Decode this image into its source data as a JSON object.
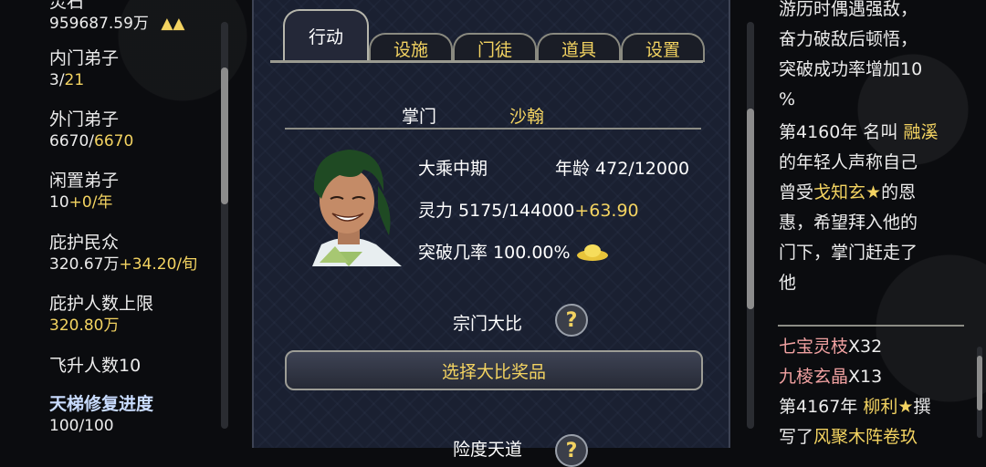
{
  "left": {
    "stats": [
      {
        "label": "灵石",
        "value": "959687.59万",
        "extra": "▲▲"
      },
      {
        "label": "内门弟子",
        "value_a": "3/",
        "value_b": "21"
      },
      {
        "label": "外门弟子",
        "value_a": "6670/",
        "value_b": "6670"
      },
      {
        "label": "闲置弟子",
        "value_a": "10",
        "value_b": "+0/年"
      },
      {
        "label": "庇护民众",
        "value_a": "320.67万",
        "value_b": "+34.20/旬"
      },
      {
        "label": "庇护人数上限",
        "value_b": "320.80万"
      },
      {
        "label": "飞升人数10"
      },
      {
        "label": "天梯修复进度",
        "value_a": "100/100"
      }
    ]
  },
  "tabs": [
    "行动",
    "设施",
    "门徒",
    "道具",
    "设置"
  ],
  "leader": {
    "title_label": "掌门",
    "name": "沙翰",
    "realm": "大乘中期",
    "age": "年龄 472/12000",
    "spirit_a": "灵力 5175/144000",
    "spirit_b": "+63.90",
    "breakthrough": "突破几率 100.00%"
  },
  "tournament": {
    "label": "宗门大比",
    "help": "?",
    "button": "选择大比奖品",
    "next_label": "险度天道"
  },
  "log": {
    "l1": "游历时偶遇强敌，",
    "l2": "奋力破敌后顿悟，",
    "l3": "突破成功率增加10",
    "l4": "%",
    "e2_a": "第4160年 名叫 ",
    "e2_name": "融溪",
    "e2_b": "的年轻人声称自己",
    "e2_c": "曾受",
    "e2_person": "戈知玄★",
    "e2_d": "的恩",
    "e2_e": "惠，希望拜入他的",
    "e2_f": "门下，掌门赶走了",
    "e2_g": "他",
    "item1_name": "七宝灵枝",
    "item1_qty": "X32",
    "item2_name": "九棱玄晶",
    "item2_qty": "X13",
    "e3_a": "第4167年 ",
    "e3_name": "柳利★",
    "e3_b": "撰",
    "e3_c": "写了",
    "e3_item": "风聚木阵卷玖"
  },
  "colors": {
    "accent": "#f3d361",
    "panel": "#1a2031",
    "item": "#f0a0a0"
  }
}
